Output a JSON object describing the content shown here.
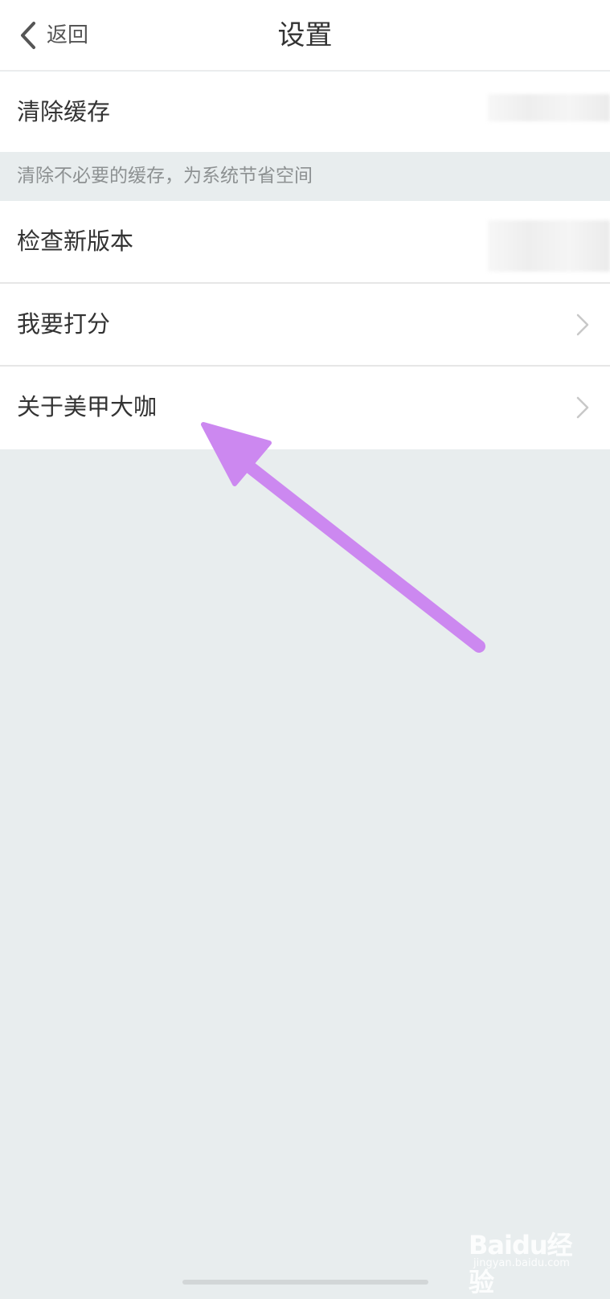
{
  "header": {
    "back_label": "返回",
    "title": "设置"
  },
  "settings": {
    "clear_cache": "清除缓存",
    "clear_cache_hint": "清除不必要的缓存，为系统节省空间",
    "check_version": "检查新版本",
    "rate": "我要打分",
    "about": "关于美甲大咖"
  },
  "annotation": {
    "arrow_color": "#cc88f0"
  },
  "watermark": {
    "logo_text": "Baidu经验",
    "url": "jingyan.baidu.com"
  },
  "colors": {
    "background": "#e8edee",
    "surface": "#ffffff",
    "text_primary": "#333333",
    "text_hint": "#8d9192",
    "chevron": "#c8c8c8"
  }
}
